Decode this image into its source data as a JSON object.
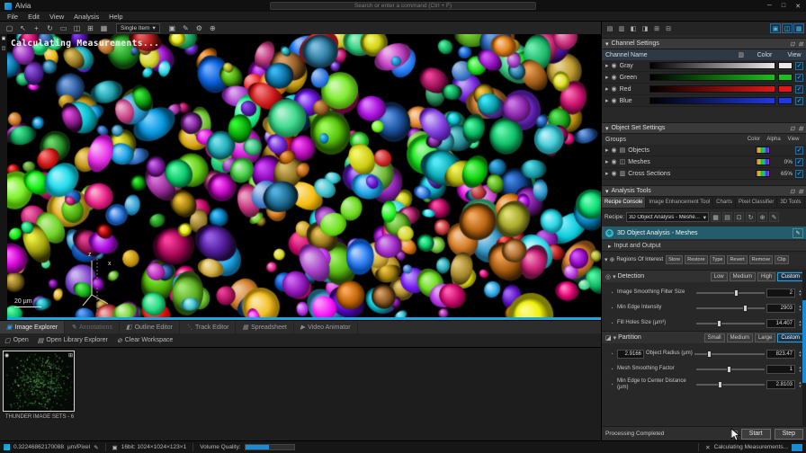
{
  "icons": {
    "chevron_right": "▸",
    "chevron_down": "▾",
    "up": "▴",
    "down": "▾",
    "eye": "◉",
    "pencil": "✎",
    "gear": "⚙",
    "check": "✓",
    "close": "✕",
    "minimize": "─",
    "maximize": "□",
    "pin": "⊡",
    "popout": "⊞",
    "dots": "···",
    "magnifier": "◎",
    "partition": "◪",
    "crosshair": "⊕",
    "histogram": "▥",
    "page": "▣",
    "panel": "◫"
  },
  "titlebar": {
    "app": "Aivia",
    "search_placeholder": "Search or enter a command (Ctrl + F)"
  },
  "menus": [
    "File",
    "Edit",
    "View",
    "Analysis",
    "Help"
  ],
  "toolbar": {
    "mode": "Single Item",
    "icons_a": [
      "▢",
      "↖",
      "+",
      "↻",
      "▭",
      "◫",
      "⊞",
      "▦"
    ],
    "icons_b": [
      "▣",
      "✎",
      "⚙",
      "⊕"
    ]
  },
  "viewport": {
    "overlay_text": "Calculating Measurements...",
    "scale_label": "20 µm",
    "axis_z": "z",
    "axis_x": "x",
    "blob_hues": [
      300,
      285,
      265,
      120,
      95,
      30,
      45,
      0,
      200,
      185,
      330,
      60,
      150,
      215
    ]
  },
  "explorer_tabs": [
    {
      "icon": "▣",
      "label": "Image Explorer"
    },
    {
      "icon": "✎",
      "label": "Annotations"
    },
    {
      "icon": "◧",
      "label": "Outline Editor"
    },
    {
      "icon": "⋱",
      "label": "Track Editor"
    },
    {
      "icon": "▦",
      "label": "Spreadsheet"
    },
    {
      "icon": "▶",
      "label": "Video Animator"
    }
  ],
  "workspace": [
    {
      "icon": "▢",
      "label": "Open"
    },
    {
      "icon": "▤",
      "label": "Open Library Explorer"
    },
    {
      "icon": "⊘",
      "label": "Clear Workspace"
    }
  ],
  "library": {
    "thumb_label": "THUNDER IMAGE SETS - 6"
  },
  "statusbar": {
    "pixel_value": "0.32246862170088",
    "pixel_unit": "µm/Pixel",
    "bit_info": "16bit: 1024×1024×123×1",
    "vq_label": "Volume Quality:",
    "task": "Calculating Measurements..."
  },
  "channels": {
    "title": "Channel Settings",
    "col_name": "Channel Name",
    "col_color": "Color",
    "col_view": "View",
    "rows": [
      {
        "name": "Gray",
        "color": "#e8e8e8"
      },
      {
        "name": "Green",
        "color": "#17c317"
      },
      {
        "name": "Red",
        "color": "#e01717"
      },
      {
        "name": "Blue",
        "color": "#2037e8"
      }
    ]
  },
  "objectsets": {
    "title": "Object Set Settings",
    "groups_label": "Groups",
    "col_color": "Color",
    "col_alpha": "Alpha",
    "col_view": "View",
    "rows": [
      {
        "icon": "▤",
        "name": "Objects",
        "alpha": ""
      },
      {
        "icon": "◫",
        "name": "Meshes",
        "alpha": "0%"
      },
      {
        "icon": "▥",
        "name": "Cross Sections",
        "alpha": "65%"
      }
    ]
  },
  "analysis": {
    "title": "Analysis Tools",
    "tabs": [
      "Recipe Console",
      "Image Enhancement Tool",
      "Charts",
      "Pixel Classifier",
      "3D Tools"
    ],
    "recipe_label": "Recipe:",
    "recipe_value": "3D Object Analysis - Meshe...",
    "recipe_icons": [
      "▦",
      "▤",
      "⊡",
      "↻",
      "⊕",
      "✎"
    ],
    "recipe_name": "3D Object Analysis - Meshes",
    "io_label": "Input and Output",
    "roi_label": "Regions Of Interest",
    "roi_buttons": [
      "Store",
      "Restore",
      "Type",
      "Revert",
      "Remove",
      "Clip"
    ],
    "detection": {
      "label": "Detection",
      "presets": [
        "Low",
        "Medium",
        "High",
        "Custom"
      ],
      "params": [
        {
          "label": "Image Smoothing Filter Size",
          "value": "2"
        },
        {
          "label": "Min Edge Intensity",
          "value": "2903"
        },
        {
          "label": "Fill Holes Size (µm³)",
          "value": "14.407"
        }
      ]
    },
    "partition": {
      "label": "Partition",
      "presets": [
        "Small",
        "Medium",
        "Large",
        "Custom"
      ],
      "params": [
        {
          "label": "Object Radius (µm)",
          "min": "2.9166",
          "value": "823.47"
        },
        {
          "label": "Mesh Smoothing Factor",
          "value": "1"
        },
        {
          "label": "Min Edge to Center Distance (µm)",
          "value": "2.8103"
        }
      ]
    },
    "footer": {
      "status": "Processing Completed",
      "start": "Start",
      "step": "Step"
    }
  },
  "rp_icons": [
    "▤",
    "▥",
    "◧",
    "◨",
    "⊞",
    "⊟"
  ],
  "rp_icons_active": [
    "▣",
    "◫",
    "▦"
  ],
  "colors": {
    "accent": "#1d8bd4",
    "recipe_bar": "#255c6b",
    "viewport_line": "#1da7e0"
  }
}
